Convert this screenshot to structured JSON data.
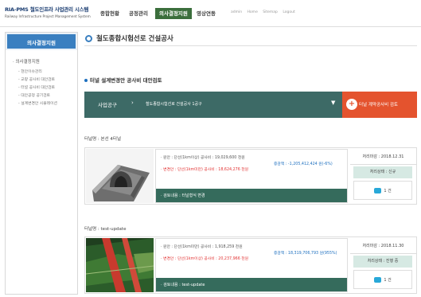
{
  "header": {
    "logo_title": "RIA-PMS 철도인프라 사업관리 시스템",
    "logo_subtitle": "Railway Infrastructure Project Management System",
    "nav": [
      "종합현황",
      "공정관리",
      "의사결정지원",
      "영상연동"
    ],
    "util": [
      "admin",
      "Home",
      "Sitemap",
      "Logout"
    ]
  },
  "sidebar": {
    "title": "의사결정지원",
    "section": "의사결정지원",
    "items": [
      "현안이슈관리",
      "교량 공사비 대안검토",
      "터널 공사비 대안검토",
      "대안공정 공기검토",
      "설계변경안 시뮬레이션"
    ]
  },
  "main": {
    "title": "철도종합시험선로 건설공사",
    "subtitle": "터널 설계변경안 공사비 대안검토",
    "selector": {
      "label": "사업공구",
      "value": "철도종합시험선로 건설공사 1공구",
      "button": "터널 계약공사비 검토"
    },
    "tunnels": [
      {
        "name": "터널명 : 본선 4터널",
        "original": "· 원안 : 단선(1km이상)    공사비 : 19,029,600 천원",
        "change": "· 변경안 : 단선(1km미만)    공사비 : 18,624,276 천원",
        "increase": "증감액 : -1,205,412,424 원(-6%)",
        "review": "· 검토내용 : 터널형식 변경",
        "deadline": "처리마감 : 2018.12.31",
        "status": "처리상태 : 신규",
        "comments": "1 건"
      },
      {
        "name": "터널명 : test-update",
        "original": "· 원안 : 단선(1km미만)    공사비 : 1,918,259 천원",
        "change": "· 변경안 : 단선(1km이상)    공사비 : 20,237,966 천원",
        "increase": "증감액 : 18,319,706,793 원(955%)",
        "review": "· 검토내용 : test-update",
        "deadline": "처리마감 : 2018.11.30",
        "status": "처리상태 : 진행 중",
        "comments": "1 건"
      }
    ]
  },
  "colors": {
    "sidebar_accent": "#3a7fc0",
    "nav_active": "#3b6e3c",
    "selector_bg": "#3d6a66",
    "button_bg": "#e4532e",
    "change_text": "#e23333",
    "increase_text": "#1d6fbf"
  }
}
